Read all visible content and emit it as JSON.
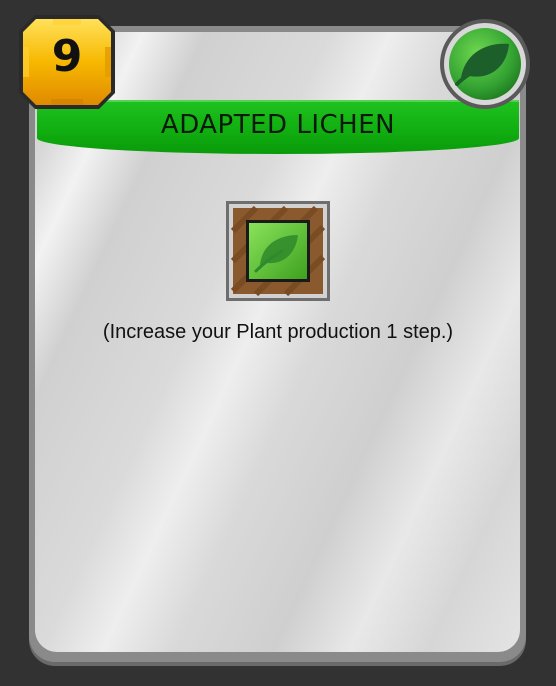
{
  "card": {
    "title": "ADAPTED LICHEN",
    "cost": "9",
    "tag_icon": "plant-leaf-icon",
    "production_icon": "plant-production-icon",
    "description": "(Increase your Plant production 1 step.)"
  },
  "colors": {
    "background": "#323232",
    "title_band": "#12b012",
    "cost_badge": "#f5b800",
    "tag_green": "#3aa53a",
    "production_frame": "#8a5a2e",
    "production_tile": "#5cc02c"
  }
}
